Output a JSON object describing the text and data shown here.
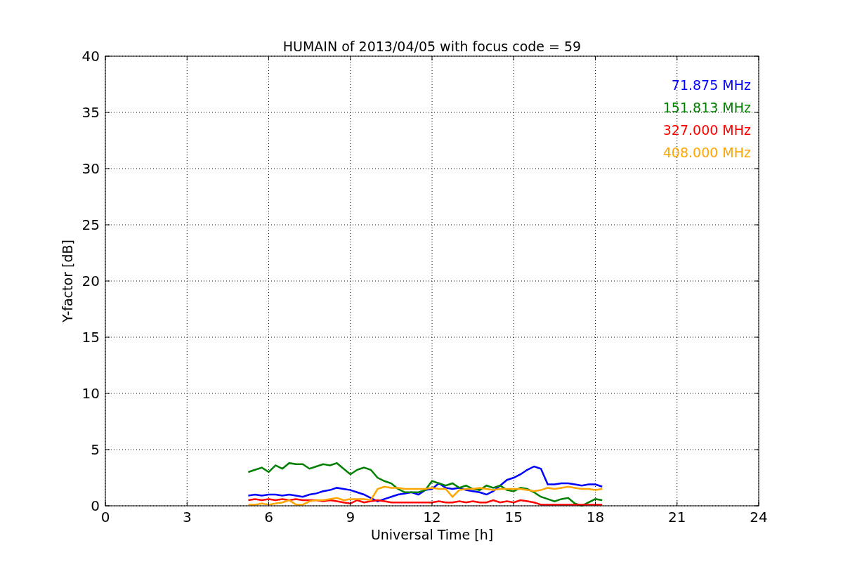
{
  "chart": {
    "chart_data": {
      "type": "line",
      "title": "HUMAIN of 2013/04/05 with focus code = 59",
      "xlabel": "Universal Time [h]",
      "ylabel": "Y-factor [dB]",
      "xlim": [
        0,
        24
      ],
      "ylim": [
        0,
        40
      ],
      "xticks": [
        0,
        3,
        6,
        9,
        12,
        15,
        18,
        21,
        24
      ],
      "yticks": [
        0,
        5,
        10,
        15,
        20,
        25,
        30,
        35,
        40
      ],
      "grid": true,
      "x": [
        5.25,
        5.5,
        5.75,
        6,
        6.25,
        6.5,
        6.75,
        7,
        7.25,
        7.5,
        7.75,
        8,
        8.25,
        8.5,
        8.75,
        9,
        9.25,
        9.5,
        9.75,
        10,
        10.25,
        10.5,
        10.75,
        11,
        11.25,
        11.5,
        11.75,
        12,
        12.25,
        12.5,
        12.75,
        13,
        13.25,
        13.5,
        13.75,
        14,
        14.25,
        14.5,
        14.75,
        15,
        15.25,
        15.5,
        15.75,
        16,
        16.25,
        16.5,
        16.75,
        17,
        17.25,
        17.5,
        17.75,
        18,
        18.25
      ],
      "series": [
        {
          "name": "71.875 MHz",
          "color": "#0000ff",
          "values": [
            0.9,
            1.0,
            0.9,
            1.0,
            1.0,
            0.9,
            1.0,
            0.9,
            0.8,
            1.0,
            1.1,
            1.3,
            1.4,
            1.6,
            1.5,
            1.4,
            1.2,
            1.0,
            0.7,
            0.4,
            0.6,
            0.8,
            1.0,
            1.1,
            1.2,
            1.0,
            1.4,
            1.5,
            2.0,
            1.6,
            1.5,
            1.6,
            1.4,
            1.3,
            1.2,
            1.0,
            1.3,
            1.8,
            2.3,
            2.5,
            2.8,
            3.2,
            3.5,
            3.3,
            1.9,
            1.9,
            2.0,
            2.0,
            1.9,
            1.8,
            1.9,
            1.9,
            1.7
          ]
        },
        {
          "name": "151.813 MHz",
          "color": "#008000",
          "values": [
            3.0,
            3.2,
            3.4,
            3.0,
            3.6,
            3.3,
            3.8,
            3.7,
            3.7,
            3.3,
            3.5,
            3.7,
            3.6,
            3.8,
            3.3,
            2.8,
            3.2,
            3.4,
            3.2,
            2.5,
            2.2,
            2.0,
            1.5,
            1.2,
            1.2,
            1.2,
            1.4,
            2.2,
            2.0,
            1.8,
            2.0,
            1.6,
            1.8,
            1.5,
            1.4,
            1.8,
            1.6,
            1.8,
            1.4,
            1.3,
            1.6,
            1.5,
            1.2,
            0.8,
            0.6,
            0.4,
            0.6,
            0.7,
            0.2,
            0.0,
            0.3,
            0.6,
            0.5
          ]
        },
        {
          "name": "327.000 MHz",
          "color": "#ff0000",
          "values": [
            0.5,
            0.6,
            0.5,
            0.6,
            0.5,
            0.6,
            0.5,
            0.6,
            0.5,
            0.5,
            0.5,
            0.4,
            0.5,
            0.4,
            0.3,
            0.2,
            0.5,
            0.3,
            0.4,
            0.5,
            0.4,
            0.3,
            0.3,
            0.3,
            0.3,
            0.3,
            0.3,
            0.3,
            0.4,
            0.3,
            0.3,
            0.4,
            0.3,
            0.4,
            0.3,
            0.3,
            0.5,
            0.3,
            0.4,
            0.3,
            0.5,
            0.4,
            0.3,
            0.1,
            0.1,
            0.1,
            0.1,
            0.1,
            0.1,
            0.1,
            0.1,
            0.1,
            0.1
          ]
        },
        {
          "name": "408.000 MHz",
          "color": "#ffa500",
          "values": [
            0.1,
            0.1,
            0.2,
            0.1,
            0.2,
            0.3,
            0.5,
            0.1,
            0.1,
            0.4,
            0.5,
            0.5,
            0.6,
            0.7,
            0.5,
            0.6,
            0.6,
            0.6,
            0.5,
            1.5,
            1.7,
            1.6,
            1.6,
            1.5,
            1.5,
            1.5,
            1.5,
            1.6,
            1.5,
            1.5,
            0.8,
            1.4,
            1.5,
            1.5,
            1.6,
            1.5,
            1.4,
            1.5,
            1.5,
            1.5,
            1.5,
            1.4,
            1.3,
            1.4,
            1.6,
            1.5,
            1.6,
            1.7,
            1.6,
            1.5,
            1.5,
            1.4,
            1.5
          ]
        }
      ]
    }
  }
}
